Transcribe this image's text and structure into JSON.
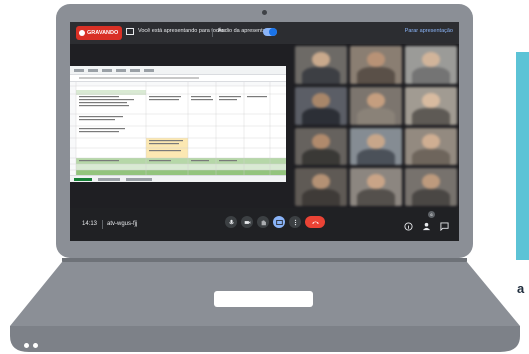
{
  "topbar": {
    "recording_label": "GRAVANDO",
    "presenting_text": "Você está apresentando para todos",
    "audio_text": "Áudio da apresentação",
    "stop_label": "Parar apresentação"
  },
  "bottombar": {
    "time": "14:13",
    "meeting_code": "atv-wgus-fjj",
    "participant_count": "6"
  },
  "side_text": "a",
  "colors": {
    "recording": "#d93025",
    "accent": "#8ab4f8",
    "end_call": "#ea4335",
    "laptop": "#8b8f96",
    "side_card": "#5cc3d6"
  },
  "icons": [
    "present-icon",
    "mic-icon",
    "camera-icon",
    "hand-icon",
    "share-screen-icon",
    "more-icon",
    "end-call-icon",
    "info-icon",
    "people-icon",
    "chat-icon"
  ]
}
